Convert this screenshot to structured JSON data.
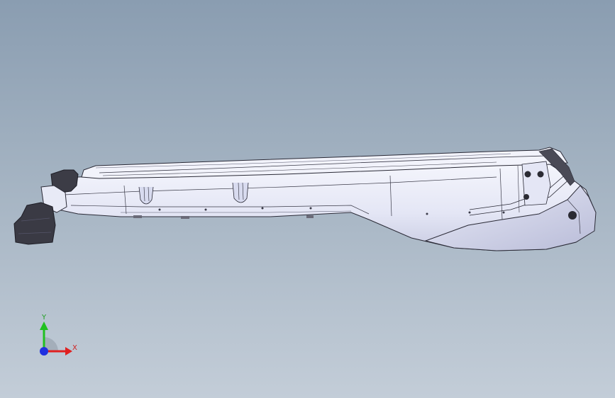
{
  "triad": {
    "x_label": "X",
    "y_label": "Y",
    "x_color": "#e02020",
    "y_color": "#20c020",
    "z_color": "#2030e0"
  },
  "model": {
    "body_color": "#eef0fa",
    "shade_color": "#c9cce4",
    "edge_color": "#2a2a36",
    "dark_color": "#3a3a44"
  }
}
